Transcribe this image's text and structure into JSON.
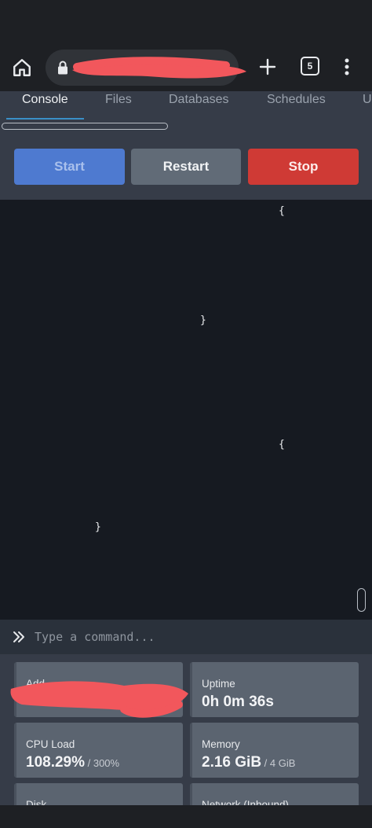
{
  "browser": {
    "tab_count": "5",
    "url": ""
  },
  "nav_tabs": [
    {
      "label": "Console",
      "active": true
    },
    {
      "label": "Files"
    },
    {
      "label": "Databases"
    },
    {
      "label": "Schedules"
    },
    {
      "label": "U"
    }
  ],
  "controls": {
    "start_label": "Start",
    "restart_label": "Restart",
    "stop_label": "Stop"
  },
  "console": {
    "lines": [
      "{",
      "}",
      "{",
      "}"
    ]
  },
  "command": {
    "placeholder": "Type a command..."
  },
  "stats": {
    "address": {
      "label": "Add"
    },
    "uptime": {
      "label": "Uptime",
      "value": "0h 0m 36s"
    },
    "cpu": {
      "label": "CPU Load",
      "value": "108.29%",
      "limit": " / 300%"
    },
    "memory": {
      "label": "Memory",
      "value": "2.16 GiB",
      "limit": " / 4 GiB"
    },
    "disk": {
      "label": "Disk"
    },
    "network": {
      "label": "Network (Inbound)"
    }
  },
  "colors": {
    "accent": "#3a8fc7",
    "start": "#4e7ad0",
    "restart": "#616b77",
    "stop": "#cf3a35",
    "redaction": "#f2575c"
  }
}
